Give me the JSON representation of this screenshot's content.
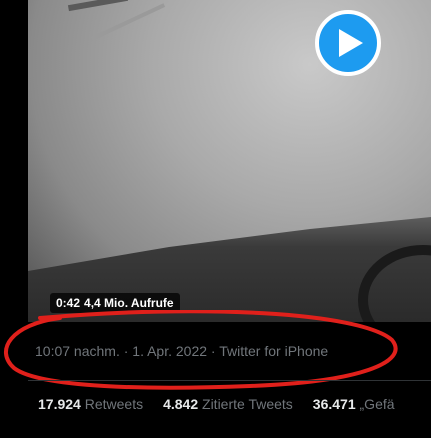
{
  "video": {
    "duration": "0:42",
    "views": "4,4 Mio. Aufrufe"
  },
  "tweet_meta": {
    "time": "10:07 nachm.",
    "date": "1. Apr. 2022",
    "client": "Twitter for iPhone",
    "sep": "·"
  },
  "stats": [
    {
      "count": "17.924",
      "label": "Retweets"
    },
    {
      "count": "4.842",
      "label": "Zitierte Tweets"
    },
    {
      "count": "36.471",
      "label": "„Gefä"
    }
  ],
  "colors": {
    "accent": "#1d9bf0",
    "annotation": "#e0201b",
    "muted_text": "#71767b"
  },
  "icons": {
    "play": "play-icon"
  }
}
